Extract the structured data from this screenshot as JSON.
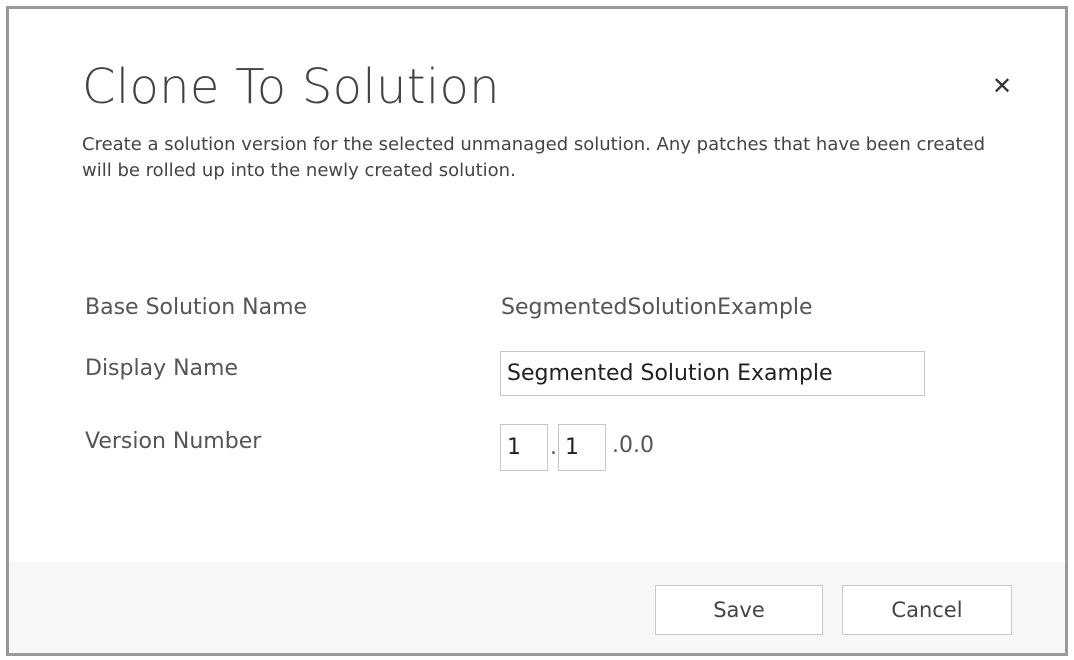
{
  "dialog": {
    "title": "Clone To Solution",
    "close_icon": "close-icon",
    "close_glyph": "✕",
    "description": "Create a solution version for the selected unmanaged solution. Any patches that have been created will be rolled up into the newly created solution."
  },
  "fields": {
    "base_solution_name": {
      "label": "Base Solution Name",
      "value": "SegmentedSolutionExample"
    },
    "display_name": {
      "label": "Display Name",
      "value": "Segmented Solution Example"
    },
    "version_number": {
      "label": "Version Number",
      "major": "1",
      "separator": ".",
      "minor": "1",
      "suffix": ".0.0"
    }
  },
  "footer": {
    "save_label": "Save",
    "cancel_label": "Cancel"
  }
}
